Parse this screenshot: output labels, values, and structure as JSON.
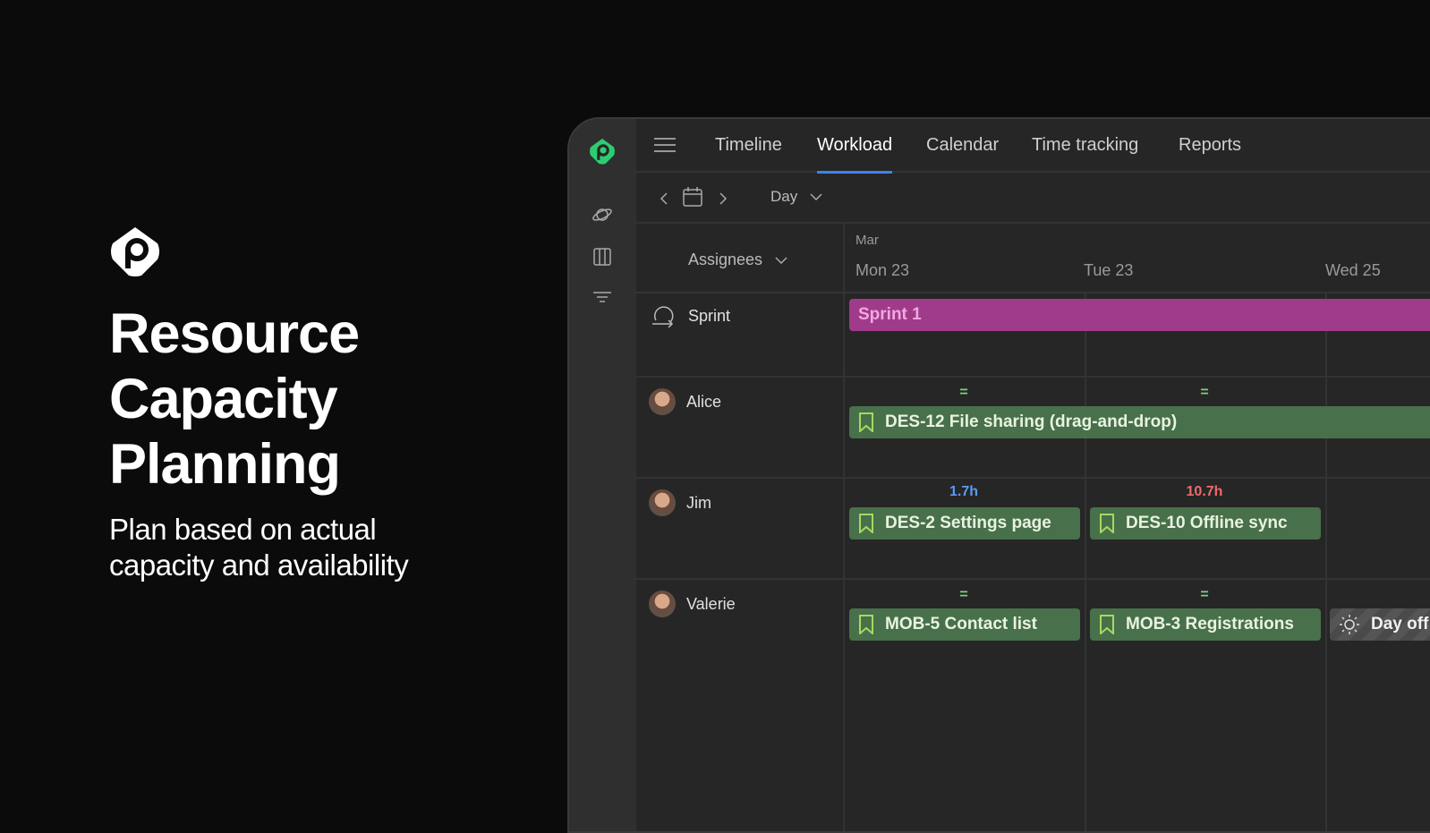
{
  "hero": {
    "title": "Resource Capacity Planning",
    "subtitle": "Plan based on actual capacity and availability"
  },
  "tabs": [
    {
      "label": "Timeline"
    },
    {
      "label": "Workload"
    },
    {
      "label": "Calendar"
    },
    {
      "label": "Time tracking"
    },
    {
      "label": "Reports"
    }
  ],
  "toolbar": {
    "view": "Day"
  },
  "grid": {
    "group_by": "Assignees",
    "month": "Mar",
    "days": [
      "Mon 23",
      "Tue 23",
      "Wed 25"
    ]
  },
  "rows": {
    "sprint": {
      "label": "Sprint",
      "bar": "Sprint 1"
    },
    "alice": {
      "name": "Alice",
      "caps": [
        "=",
        "="
      ],
      "tasks": [
        "DES-12 File sharing (drag-and-drop)"
      ]
    },
    "jim": {
      "name": "Jim",
      "caps": [
        "1.7h",
        "10.7h"
      ],
      "tasks": [
        "DES-2 Settings page",
        "DES-10 Offline sync"
      ]
    },
    "valerie": {
      "name": "Valerie",
      "caps": [
        "=",
        "="
      ],
      "tasks": [
        "MOB-5 Contact list",
        "MOB-3 Registrations"
      ],
      "dayoff": "Day off"
    }
  },
  "colors": {
    "accent": "#3b82f6",
    "brand": "#2ecc71",
    "sprint": "#a03b8a",
    "task": "#48704a",
    "under": "#5b9cf0",
    "over": "#f06a6a",
    "ok": "#7ed07e"
  }
}
